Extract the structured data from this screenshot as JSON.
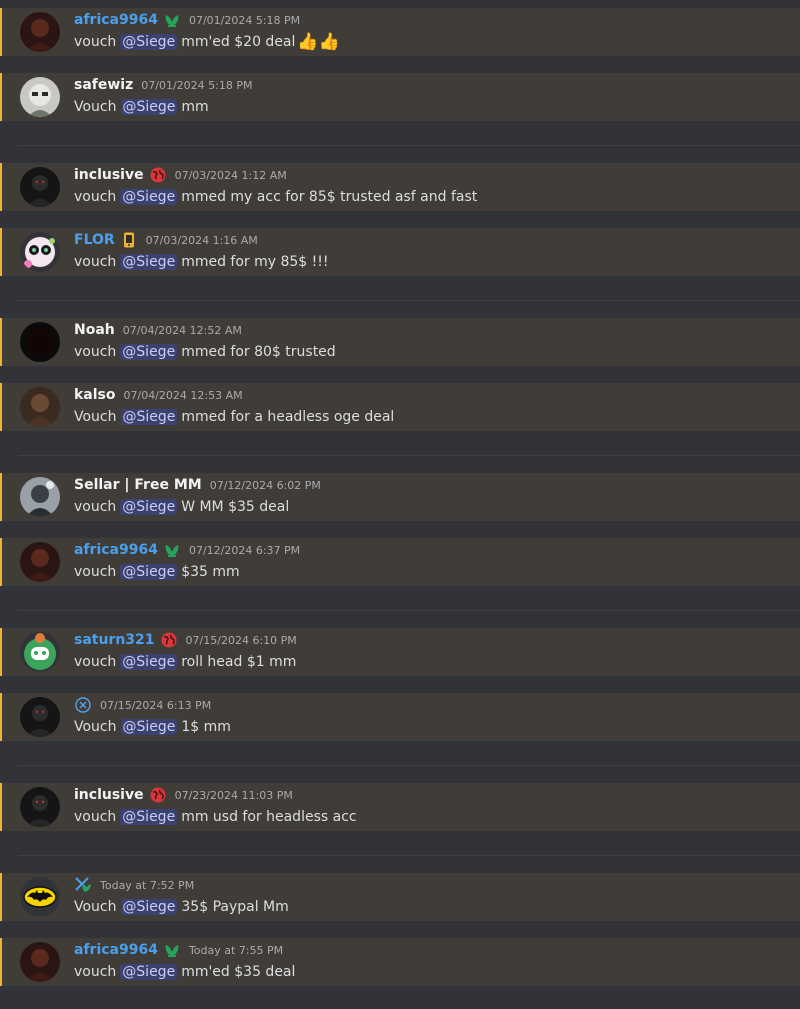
{
  "messages": [
    {
      "name": "africa9964",
      "name_color": "#4aa0ee",
      "badge": "green-leaf-badge-icon",
      "time": "07/01/2024 5:18 PM",
      "pre": "vouch",
      "mention": "@Siege",
      "post": "mm'ed $20 deal",
      "emoji": "👍👍",
      "avatar": "dark-red-avatar"
    },
    {
      "name": "safewiz",
      "name_color": "#f2f3f5",
      "badge": "",
      "time": "07/01/2024 5:18 PM",
      "pre": "Vouch",
      "mention": "@Siege",
      "post": "mm",
      "emoji": "",
      "avatar": "white-mask-avatar"
    },
    {
      "name": "inclusive",
      "name_color": "#f2f3f5",
      "badge": "red-globe-badge-icon",
      "time": "07/03/2024 1:12 AM",
      "pre": "vouch",
      "mention": "@Siege",
      "post": "mmed my acc for 85$ trusted asf and fast",
      "emoji": "",
      "avatar": "dark-figure-avatar"
    },
    {
      "name": "FLOR",
      "name_color": "#4aa0ee",
      "badge": "yellow-phone-badge-icon",
      "time": "07/03/2024 1:16 AM",
      "pre": "vouch",
      "mention": "@Siege",
      "post": "mmed for my 85$ !!!",
      "emoji": "",
      "avatar": "flower-avatar"
    },
    {
      "name": "Noah",
      "name_color": "#f2f3f5",
      "badge": "",
      "time": "07/04/2024 12:52 AM",
      "pre": "vouch",
      "mention": "@Siege",
      "post": "mmed for 80$ trusted",
      "emoji": "",
      "avatar": "black-avatar"
    },
    {
      "name": "kalso",
      "name_color": "#f2f3f5",
      "badge": "",
      "time": "07/04/2024 12:53 AM",
      "pre": "Vouch",
      "mention": "@Siege",
      "post": "mmed for a headless oge deal",
      "emoji": "",
      "avatar": "brown-figure-avatar"
    },
    {
      "name": "Sellar | Free MM",
      "name_color": "#f2f3f5",
      "badge": "",
      "time": "07/12/2024 6:02 PM",
      "pre": "vouch",
      "mention": "@Siege",
      "post": "W MM $35 deal",
      "emoji": "",
      "avatar": "grey-figure-avatar"
    },
    {
      "name": "africa9964",
      "name_color": "#4aa0ee",
      "badge": "green-leaf-badge-icon",
      "time": "07/12/2024 6:37 PM",
      "pre": "vouch",
      "mention": "@Siege",
      "post": "$35 mm",
      "emoji": "",
      "avatar": "dark-red-avatar"
    },
    {
      "name": "saturn321",
      "name_color": "#4aa0ee",
      "badge": "red-globe-badge-icon",
      "time": "07/15/2024 6:10 PM",
      "pre": "vouch",
      "mention": "@Siege",
      "post": "roll head $1 mm",
      "emoji": "",
      "avatar": "discord-green-avatar"
    },
    {
      "name": "",
      "name_color": "#4aa0ee",
      "badge": "x-circle-badge-icon",
      "time": "07/15/2024 6:13 PM",
      "pre": "Vouch",
      "mention": "@Siege",
      "post": "1$ mm",
      "emoji": "",
      "avatar": "dark-figure-avatar"
    },
    {
      "name": "inclusive",
      "name_color": "#f2f3f5",
      "badge": "red-globe-badge-icon",
      "time": "07/23/2024 11:03 PM",
      "pre": "vouch",
      "mention": "@Siege",
      "post": "mm usd for headless acc",
      "emoji": "",
      "avatar": "dark-figure-avatar"
    },
    {
      "name": "",
      "name_color": "#4aa0ee",
      "badge": "x-leaf-badge-icon",
      "time": "Today at 7:52 PM",
      "pre": "Vouch",
      "mention": "@Siege",
      "post": "35$ Paypal Mm",
      "emoji": "",
      "avatar": "batman-avatar"
    },
    {
      "name": "africa9964",
      "name_color": "#4aa0ee",
      "badge": "green-leaf-badge-icon",
      "time": "Today at 7:55 PM",
      "pre": "vouch",
      "mention": "@Siege",
      "post": "mm'ed $35 deal",
      "emoji": "",
      "avatar": "dark-red-avatar"
    }
  ],
  "colors": {
    "background": "#313338",
    "message_highlight": "#403d38",
    "highlight_border": "#f0b232",
    "mention_bg": "#3c4270",
    "mention_text": "#c9cdfb"
  }
}
